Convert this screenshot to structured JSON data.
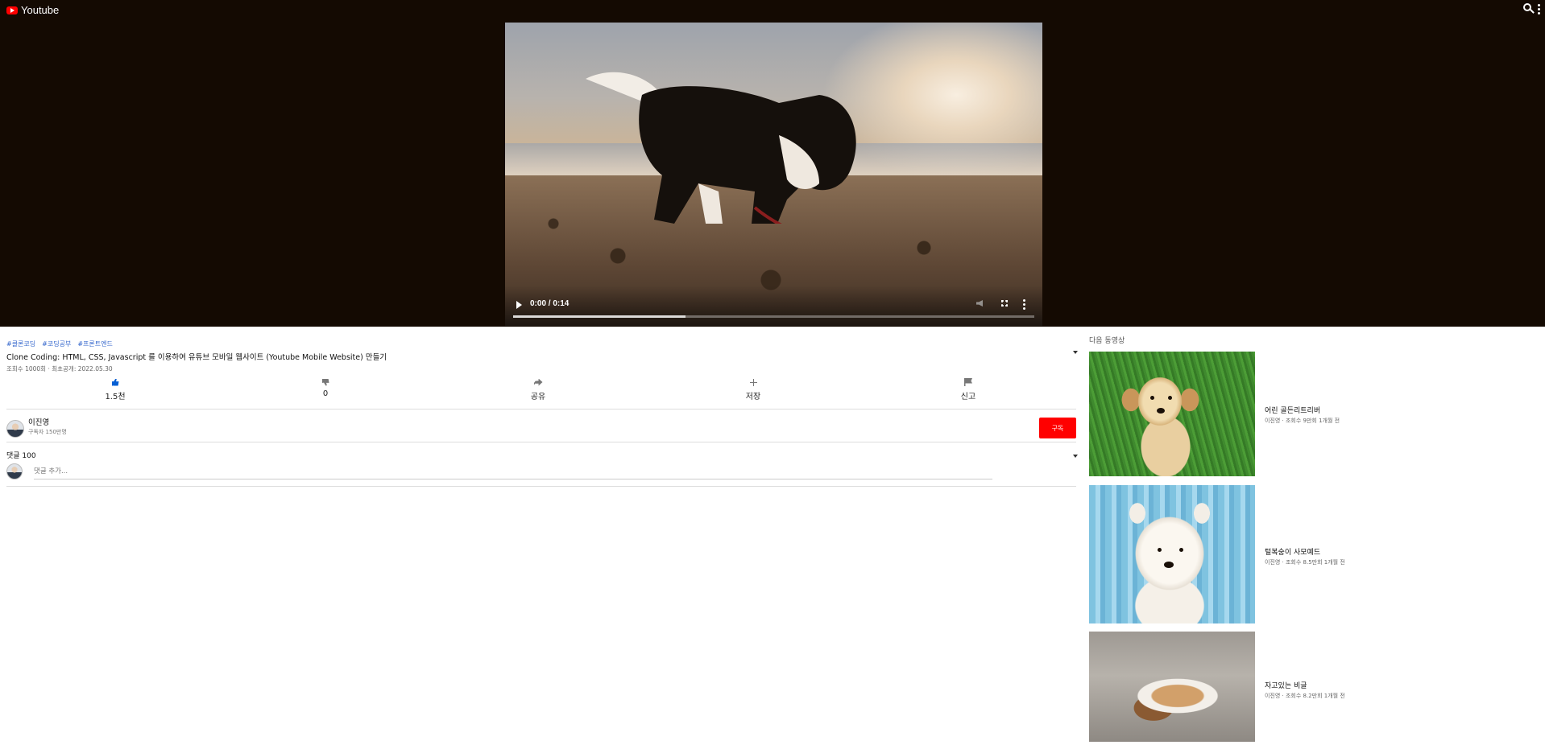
{
  "header": {
    "logo_text": "Youtube",
    "icons": [
      "search-icon",
      "more-vert-icon"
    ]
  },
  "video": {
    "time": "0:00 / 0:14",
    "progress": 0.33
  },
  "info": {
    "tags": [
      "#클론코딩",
      "#코딩공부",
      "#프론트엔드"
    ],
    "title": "Clone Coding: HTML, CSS, Javascript 를 이용하여 유튜브 모바일 웹사이트 (Youtube Mobile Website) 만들기",
    "meta": "조회수 1000회 · 최초공개: 2022.05.30"
  },
  "actions": [
    {
      "icon": "thumbs-up-icon",
      "label": "1.5천"
    },
    {
      "icon": "thumbs-down-icon",
      "label": "0"
    },
    {
      "icon": "share-icon",
      "label": "공유"
    },
    {
      "icon": "plus-icon",
      "label": "저장"
    },
    {
      "icon": "flag-icon",
      "label": "신고"
    }
  ],
  "channel": {
    "name": "이진영",
    "subscribers": "구독자 150만명",
    "subscribe_label": "구독"
  },
  "comments": {
    "header": "댓글 100",
    "placeholder": "댓글 추가..."
  },
  "sidebar": {
    "header": "다음 동영상",
    "videos": [
      {
        "title": "어린 골든리트리버",
        "meta": "이진영 · 조회수 9만회 1개월 전"
      },
      {
        "title": "털복숭이 사모예드",
        "meta": "이진영 · 조회수 8.5만회 1개월 전"
      },
      {
        "title": "자고있는 비글",
        "meta": "이진영 · 조회수 8.2만회 1개월 전"
      }
    ]
  },
  "colors": {
    "accent": "#065fd4",
    "subscribe": "#ff0000",
    "top_background": "#140a02"
  }
}
